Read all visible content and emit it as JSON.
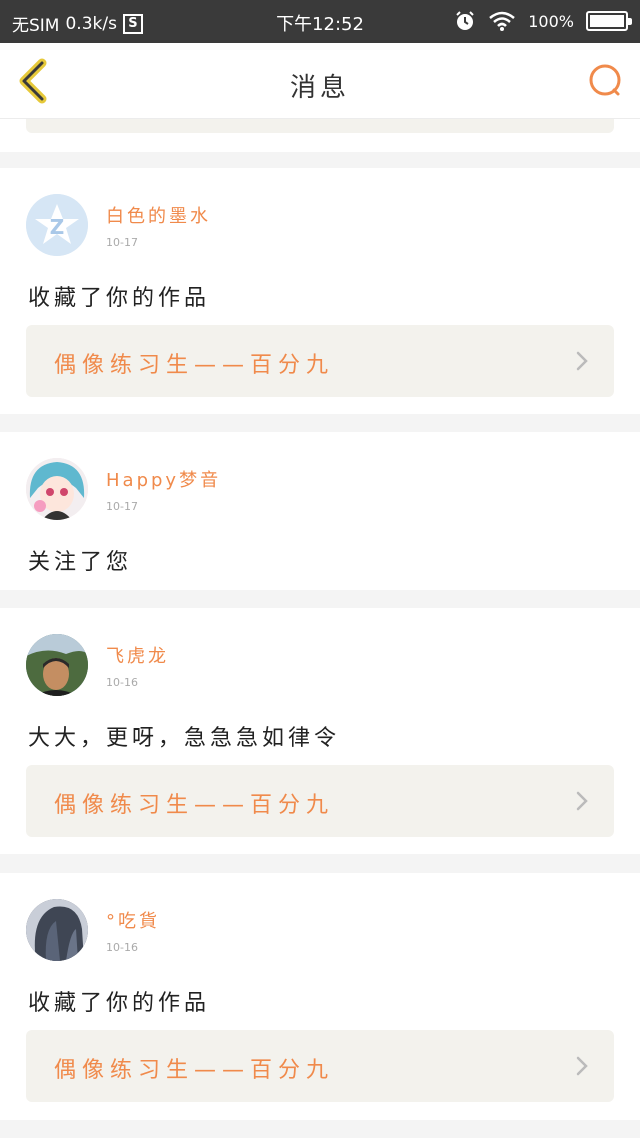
{
  "status_bar": {
    "carrier": "无SIM",
    "speed": "0.3k/s",
    "sim_icon_letter": "S",
    "time": "下午12:52",
    "battery": "100%"
  },
  "header": {
    "title": "消息",
    "back_icon": "chevron-left-icon",
    "search_icon": "search-icon"
  },
  "messages": [
    {
      "username": "白色的墨水",
      "date": "10-17",
      "text": "收藏了你的作品",
      "work_title": "偶像练习生——百分九",
      "avatar": "default-qq-avatar"
    },
    {
      "username": "Happy梦音",
      "date": "10-17",
      "text": "关注了您",
      "avatar": "anime-avatar"
    },
    {
      "username": "飞虎龙",
      "date": "10-16",
      "text": "大大，更呀，急急急如律令",
      "work_title": "偶像练习生——百分九",
      "avatar": "photo-avatar"
    },
    {
      "username": "°吃貨",
      "date": "10-16",
      "text": "收藏了你的作品",
      "work_title": "偶像练习生——百分九",
      "avatar": "hair-avatar"
    }
  ],
  "colors": {
    "accent": "#f08a4b",
    "status_bar_bg": "#3a3a3a",
    "card_inner_bg": "#f3f2ed",
    "page_bg": "#f4f4f4"
  }
}
